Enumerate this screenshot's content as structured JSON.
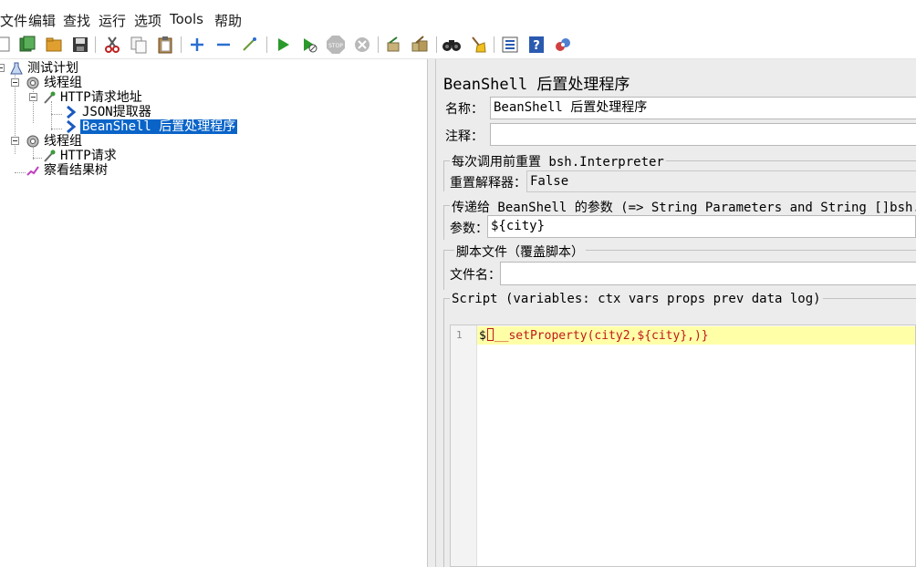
{
  "menu": {
    "items": [
      "文件",
      "编辑",
      "查找",
      "运行",
      "选项",
      "Tools",
      "帮助"
    ]
  },
  "toolbar": {
    "icons": [
      "new-icon",
      "templates-icon",
      "open-icon",
      "save-icon",
      "cut-icon",
      "copy-icon",
      "paste-icon",
      "expand-icon",
      "collapse-icon",
      "toggle-icon",
      "start-icon",
      "start-no-pause-icon",
      "stop-icon",
      "shutdown-icon",
      "clear-icon",
      "clear-all-icon",
      "search-icon",
      "reset-search-icon",
      "function-helper-icon",
      "help-icon",
      "remote-icon"
    ]
  },
  "tree": {
    "nodes": [
      {
        "label": "测试计划",
        "icon": "test-plan-icon",
        "selected": false
      },
      {
        "label": "线程组",
        "icon": "thread-group-icon",
        "selected": false
      },
      {
        "label": "HTTP请求地址",
        "icon": "sampler-icon",
        "selected": false
      },
      {
        "label": "JSON提取器",
        "icon": "post-processor-icon",
        "selected": false
      },
      {
        "label": "BeanShell 后置处理程序",
        "icon": "post-processor-icon",
        "selected": true
      },
      {
        "label": "线程组",
        "icon": "thread-group-icon",
        "selected": false
      },
      {
        "label": "HTTP请求",
        "icon": "sampler-icon",
        "selected": false
      },
      {
        "label": "察看结果树",
        "icon": "listener-icon",
        "selected": false
      }
    ]
  },
  "panel": {
    "title": "BeanShell 后置处理程序",
    "name_label": "名称：",
    "name_value": "BeanShell 后置处理程序",
    "comment_label": "注释：",
    "comment_value": "",
    "reset_group": {
      "title": "每次调用前重置 bsh.Interpreter",
      "label": "重置解释器：",
      "value": "False"
    },
    "params_group": {
      "title": "传递给 BeanShell 的参数 (=> String Parameters and String []bsh.args)",
      "label": "参数：",
      "value": "${city}"
    },
    "file_group": {
      "title": "脚本文件（覆盖脚本）",
      "label": "文件名：",
      "value": ""
    },
    "script_group": {
      "title": "Script (variables: ctx vars props prev data log)",
      "line_number": "1",
      "code_prefix": "$",
      "code_rest": "__setProperty(city2,${city},)}"
    }
  },
  "colors": {
    "selection": "#0a64c8",
    "panel_bg": "#ececec",
    "current_line": "#ffffa8",
    "code_red": "#c01818"
  }
}
